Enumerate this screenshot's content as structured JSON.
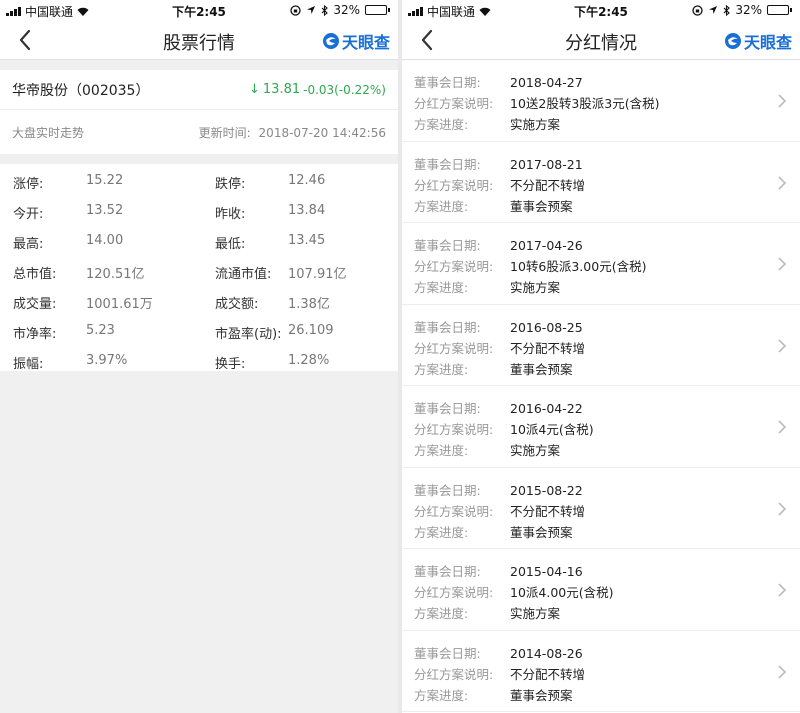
{
  "status_bar": {
    "carrier": "中国联通",
    "time": "下午2:45",
    "battery": "32%",
    "battery_level": 0.32
  },
  "left": {
    "nav_title": "股票行情",
    "brand": "天眼查",
    "stock": {
      "name": "华帝股份（002035）",
      "price": "13.81",
      "change": "-0.03(-0.22%)",
      "direction": "down"
    },
    "market_label": "大盘实时走势",
    "update_label": "更新时间:",
    "update_time": "2018-07-20 14:42:56",
    "stats": [
      [
        {
          "label": "涨停:",
          "value": "15.22"
        },
        {
          "label": "跌停:",
          "value": "12.46"
        }
      ],
      [
        {
          "label": "今开:",
          "value": "13.52"
        },
        {
          "label": "昨收:",
          "value": "13.84"
        }
      ],
      [
        {
          "label": "最高:",
          "value": "14.00"
        },
        {
          "label": "最低:",
          "value": "13.45"
        }
      ],
      [
        {
          "label": "总市值:",
          "value": "120.51亿"
        },
        {
          "label": "流通市值:",
          "value": "107.91亿"
        }
      ],
      [
        {
          "label": "成交量:",
          "value": "1001.61万"
        },
        {
          "label": "成交额:",
          "value": "1.38亿"
        }
      ],
      [
        {
          "label": "市净率:",
          "value": "5.23"
        },
        {
          "label": "市盈率(动):",
          "value": "26.109"
        }
      ],
      [
        {
          "label": "振幅:",
          "value": "3.97%"
        },
        {
          "label": "换手:",
          "value": "1.28%"
        }
      ]
    ]
  },
  "right": {
    "nav_title": "分红情况",
    "brand": "天眼查",
    "labels": {
      "date": "董事会日期:",
      "plan": "分红方案说明:",
      "progress": "方案进度:"
    },
    "items": [
      {
        "date": "2018-04-27",
        "plan": "10送2股转3股派3元(含税)",
        "progress": "实施方案"
      },
      {
        "date": "2017-08-21",
        "plan": "不分配不转增",
        "progress": "董事会预案"
      },
      {
        "date": "2017-04-26",
        "plan": "10转6股派3.00元(含税)",
        "progress": "实施方案"
      },
      {
        "date": "2016-08-25",
        "plan": "不分配不转增",
        "progress": "董事会预案"
      },
      {
        "date": "2016-04-22",
        "plan": "10派4元(含税)",
        "progress": "实施方案"
      },
      {
        "date": "2015-08-22",
        "plan": "不分配不转增",
        "progress": "董事会预案"
      },
      {
        "date": "2015-04-16",
        "plan": "10派4.00元(含税)",
        "progress": "实施方案"
      },
      {
        "date": "2014-08-26",
        "plan": "不分配不转增",
        "progress": "董事会预案"
      }
    ]
  },
  "colors": {
    "down": "#2fa84f",
    "brand": "#1a6fd4"
  },
  "icons": [
    "signal-icon",
    "wifi-icon",
    "orientation-lock-icon",
    "location-icon",
    "bluetooth-icon",
    "battery-icon",
    "back-icon",
    "tianyancha-logo-icon",
    "chevron-right-icon",
    "down-arrow-icon"
  ]
}
